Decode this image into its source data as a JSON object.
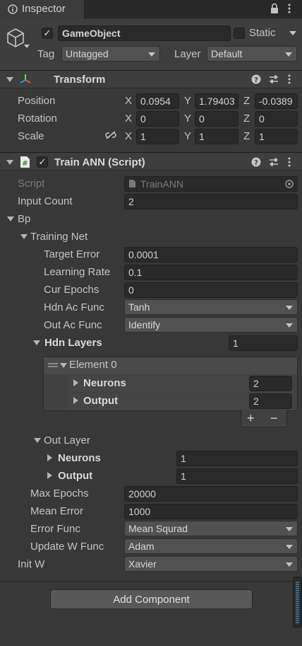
{
  "tab": {
    "title": "Inspector"
  },
  "gameobject": {
    "name": "GameObject",
    "active": true,
    "static_label": "Static",
    "tag_label": "Tag",
    "tag_value": "Untagged",
    "layer_label": "Layer",
    "layer_value": "Default"
  },
  "transform": {
    "title": "Transform",
    "position_label": "Position",
    "rotation_label": "Rotation",
    "scale_label": "Scale",
    "position": {
      "x": "0.0954",
      "y": "1.79403",
      "z": "-0.0389"
    },
    "rotation": {
      "x": "0",
      "y": "0",
      "z": "0"
    },
    "scale": {
      "x": "1",
      "y": "1",
      "z": "1"
    }
  },
  "axis": {
    "x": "X",
    "y": "Y",
    "z": "Z"
  },
  "script_comp": {
    "title": "Train ANN (Script)",
    "enabled": true,
    "script_label": "Script",
    "script_value": "TrainANN",
    "input_count_label": "Input Count",
    "input_count": "2",
    "bp_label": "Bp",
    "training_net_label": "Training Net",
    "target_error_label": "Target Error",
    "target_error": "0.0001",
    "learning_rate_label": "Learning Rate",
    "learning_rate": "0.1",
    "cur_epochs_label": "Cur Epochs",
    "cur_epochs": "0",
    "hdn_ac_func_label": "Hdn Ac Func",
    "hdn_ac_func": "Tanh",
    "out_ac_func_label": "Out Ac Func",
    "out_ac_func": "Identify",
    "hdn_layers_label": "Hdn Layers",
    "hdn_layers_count": "1",
    "element0_label": "Element 0",
    "neurons_label": "Neurons",
    "element0_neurons": "2",
    "output_label": "Output",
    "element0_output": "2",
    "plus": "+",
    "minus": "−",
    "out_layer_label": "Out Layer",
    "out_layer_neurons": "1",
    "out_layer_output": "1",
    "max_epochs_label": "Max Epochs",
    "max_epochs": "20000",
    "mean_error_label": "Mean Error",
    "mean_error": "1000",
    "error_func_label": "Error Func",
    "error_func": "Mean Squrad",
    "update_w_func_label": "Update W Func",
    "update_w_func": "Adam",
    "init_w_label": "Init W",
    "init_w": "Xavier"
  },
  "add_component": "Add Component",
  "colors": {
    "panel_bg": "#383838",
    "field_bg": "#2a2a2a",
    "header_bg": "#3e3e3e",
    "dropdown_bg": "#515151"
  },
  "icons": [
    "info-icon",
    "lock-icon",
    "more-icon",
    "cube-icon",
    "transform-axes-icon",
    "help-icon",
    "preset-icon",
    "script-icon",
    "scale-link-icon",
    "target-icon"
  ]
}
